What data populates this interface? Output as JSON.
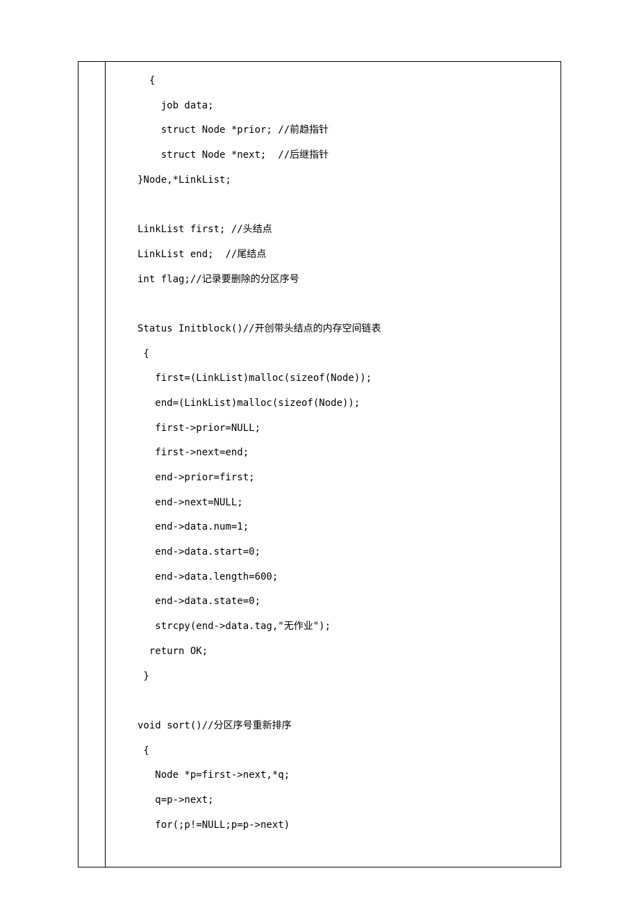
{
  "code_lines": [
    "  {",
    "    job data;",
    "    struct Node *prior; //前趋指针",
    "    struct Node *next;  //后继指针",
    "}Node,*LinkList;",
    "",
    "LinkList first; //头结点",
    "LinkList end;  //尾结点",
    "int flag;//记录要删除的分区序号",
    "",
    "Status Initblock()//开创带头结点的内存空间链表",
    " {",
    "   first=(LinkList)malloc(sizeof(Node));",
    "   end=(LinkList)malloc(sizeof(Node));",
    "   first->prior=NULL;",
    "   first->next=end;",
    "   end->prior=first;",
    "   end->next=NULL;",
    "   end->data.num=1;",
    "   end->data.start=0;",
    "   end->data.length=600;",
    "   end->data.state=0;",
    "   strcpy(end->data.tag,\"无作业\");",
    "  return OK;",
    " }",
    "",
    "void sort()//分区序号重新排序",
    " {",
    "   Node *p=first->next,*q;",
    "   q=p->next;",
    "   for(;p!=NULL;p=p->next)"
  ]
}
